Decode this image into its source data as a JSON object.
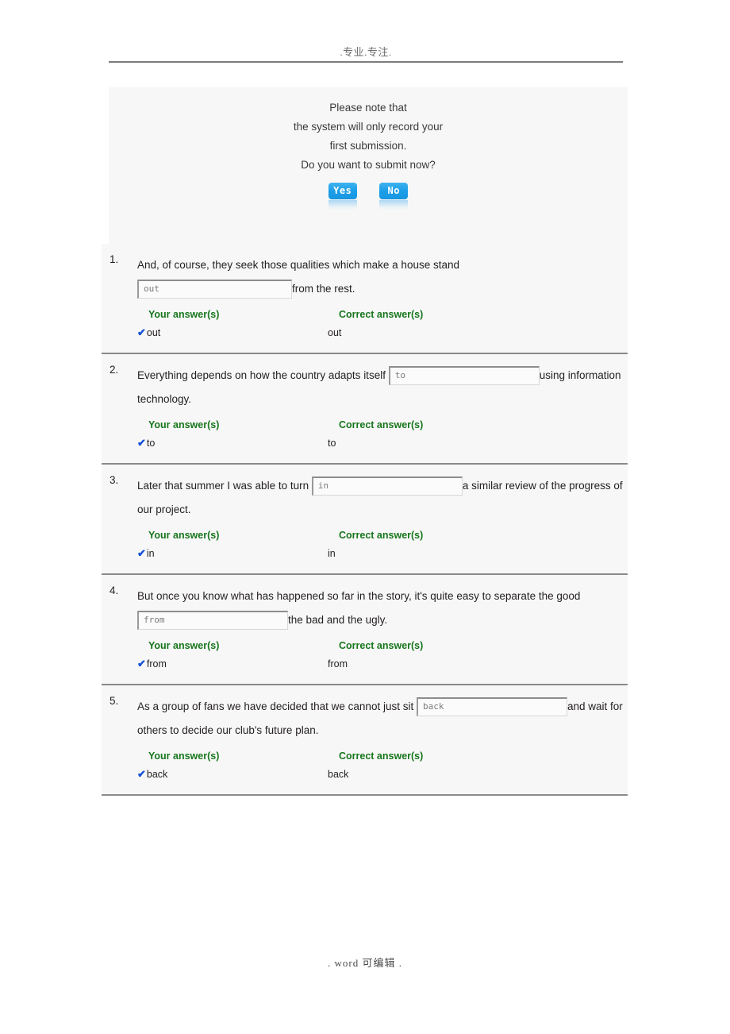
{
  "header": {
    "text": ".专业.专注."
  },
  "dialog": {
    "lines": [
      "Please note that",
      "the system will only record your",
      "first submission.",
      "Do you want to submit now?"
    ],
    "yes_label": "Yes",
    "no_label": "No",
    "accent_color": "#1c9fe8"
  },
  "answer_labels": {
    "your": "Your answer(s)",
    "correct": "Correct answer(s)",
    "check_glyph": "✔",
    "header_color": "#17761c",
    "check_color": "#1550d8"
  },
  "questions": [
    {
      "number": "1.",
      "text_before": "And, of course, they seek those qualities which make a house stand",
      "text_between": "",
      "blank_value": "out",
      "text_after": "from the rest.",
      "your_answer": "out",
      "correct_answer": "out",
      "layout": "blank-second-line"
    },
    {
      "number": "2.",
      "text_before": "Everything depends on how the country adapts itself ",
      "blank_value": "to",
      "text_after": "using information technology.",
      "your_answer": "to",
      "correct_answer": "to",
      "layout": "inline"
    },
    {
      "number": "3.",
      "text_before": "Later that summer I was able to turn ",
      "blank_value": "in",
      "text_after": "a similar review of the progress of our project.",
      "your_answer": "in",
      "correct_answer": "in",
      "layout": "inline"
    },
    {
      "number": "4.",
      "text_before": "But once you know what has happened so far in the story, it's quite easy to separate the good ",
      "blank_value": "from",
      "text_after": "the bad and the ugly.",
      "your_answer": "from",
      "correct_answer": "from",
      "layout": "inline"
    },
    {
      "number": "5.",
      "text_before": "As a group of fans we have decided that we cannot just sit ",
      "blank_value": "back",
      "text_after": "and wait for others to decide our club's future plan.",
      "your_answer": "back",
      "correct_answer": "back",
      "layout": "inline"
    }
  ],
  "footer": {
    "text": ".   word 可编辑   ."
  }
}
